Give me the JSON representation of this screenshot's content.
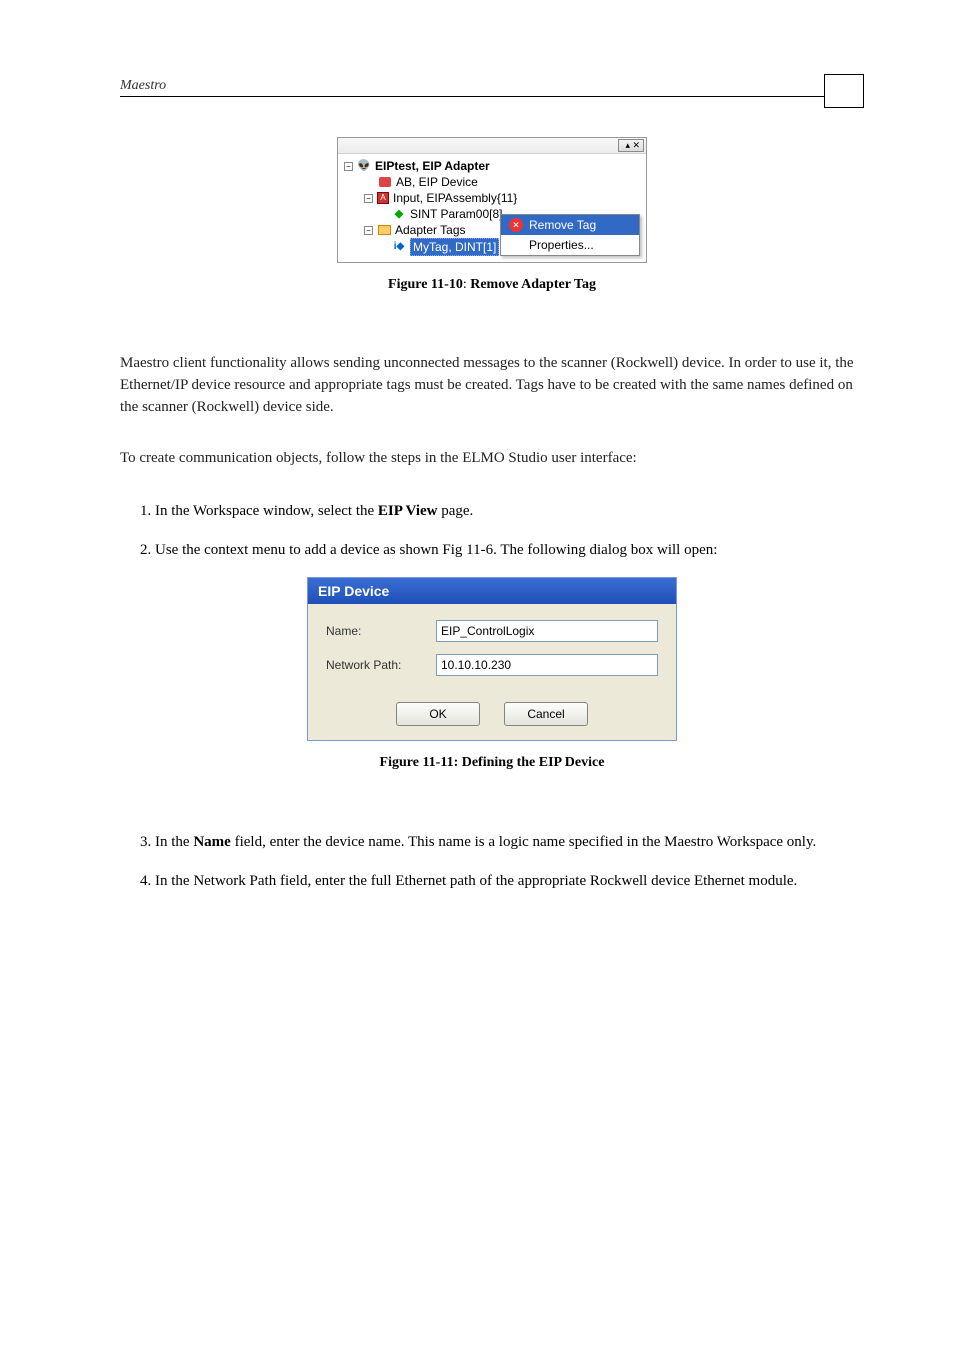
{
  "header": {
    "title": "Maestro"
  },
  "tree": {
    "close_glyph": "▴ ✕",
    "root": {
      "exp": "−",
      "label": "EIPtest, EIP Adapter"
    },
    "n1": {
      "label": "AB, EIP Device"
    },
    "n2": {
      "exp": "−",
      "label": "Input, EIPAssembly{11}"
    },
    "n2a": {
      "label": "SINT Param00[8]"
    },
    "n3": {
      "exp": "−",
      "label": "Adapter Tags"
    },
    "n3a": {
      "label": "MyTag, DINT[1]"
    },
    "ctx": {
      "remove": "Remove Tag",
      "properties": "Properties..."
    }
  },
  "caption1": {
    "prefix": "Figure 11-10",
    "sep": ": ",
    "title": "Remove Adapter Tag"
  },
  "para1": "Maestro client functionality allows sending unconnected messages to the scanner (Rockwell) device. In order to use it, the Ethernet/IP device resource and appropriate tags must be created. Tags have to be created with the same names defined on the scanner (Rockwell) device side.",
  "para2": "To create communication objects, follow the steps in the ELMO Studio user interface:",
  "steps": {
    "s1a": "1.   In the Workspace window, select the ",
    "s1b": "EIP View",
    "s1c": " page.",
    "s2": "2.   Use the context menu to add a device as shown Fig 11-6. The following dialog box will open:",
    "s3a": "3.   In the ",
    "s3b": "Name",
    "s3c": "  field, enter the device name. This name is a logic name specified in the Maestro Workspace only.",
    "s4": "4.   In the Network Path field, enter the full Ethernet path of the appropriate Rockwell device Ethernet module."
  },
  "dialog": {
    "title": "EIP Device",
    "name_label": "Name:",
    "name_value": "EIP_ControlLogix",
    "path_label": "Network Path:",
    "path_value": "10.10.10.230",
    "ok": "OK",
    "cancel": "Cancel"
  },
  "caption2": {
    "full": "Figure 11-11: Defining the EIP Device"
  }
}
